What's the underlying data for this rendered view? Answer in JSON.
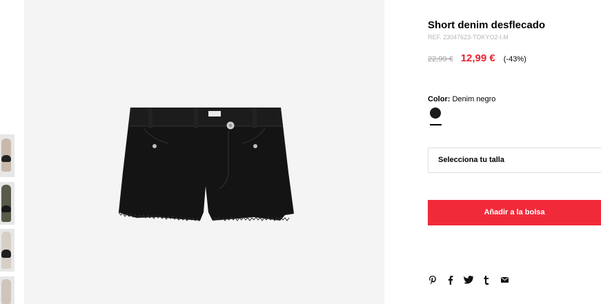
{
  "product": {
    "title": "Short denim desflecado",
    "ref": "REF. 23047623-TOKYO2-I.M",
    "old_price": "22,99 €",
    "price": "12,99 €",
    "discount": "(-43%)"
  },
  "color": {
    "label": "Color:",
    "value": "Denim negro",
    "swatch_hex": "#1b1b1b"
  },
  "size_select": {
    "label": "Selecciona tu talla"
  },
  "add_to_bag": {
    "label": "Añadir a la bolsa",
    "color": "#f12a3a"
  },
  "share": {
    "icons": [
      "pinterest-icon",
      "facebook-icon",
      "twitter-icon",
      "tumblr-icon",
      "email-icon"
    ]
  },
  "accent_price_color": "#e52330"
}
